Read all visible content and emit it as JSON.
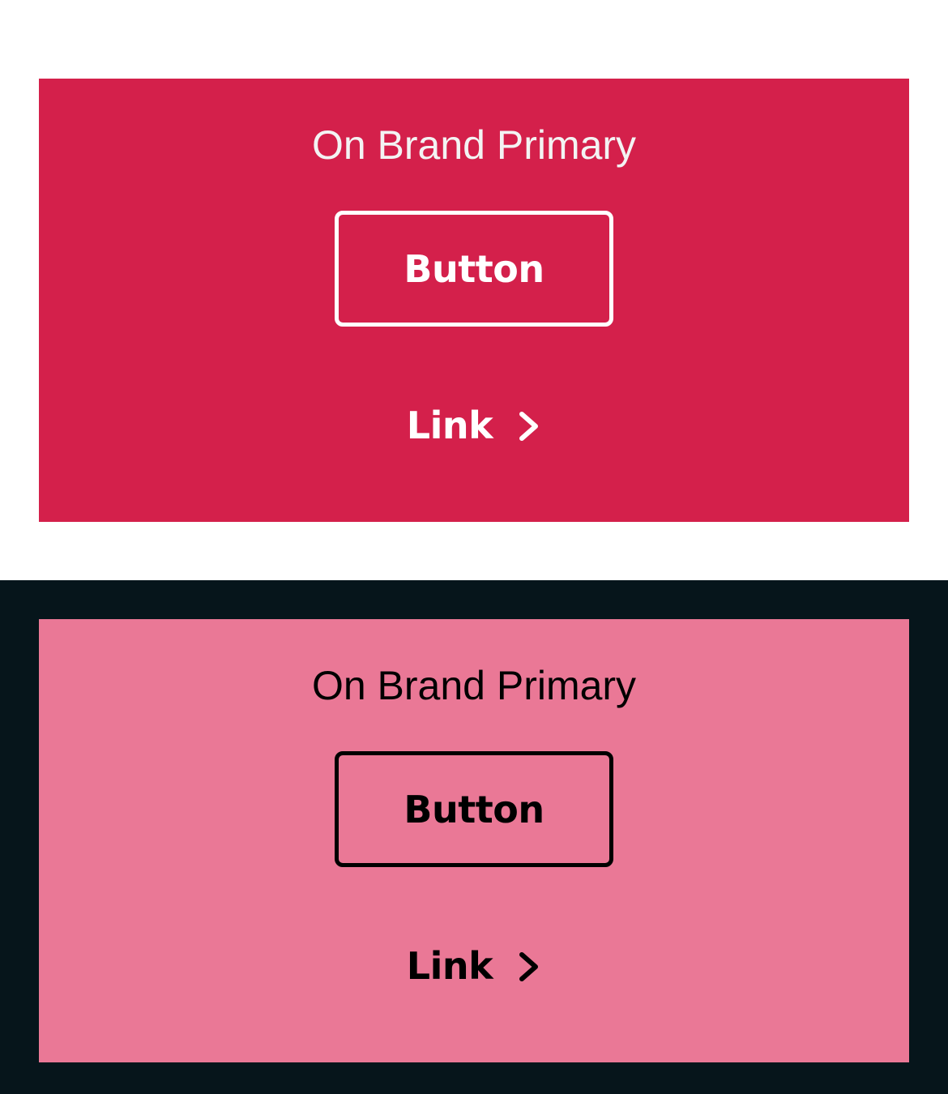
{
  "variants": [
    {
      "theme": "light",
      "page_background": "#ffffff",
      "card_background": "#d4204b",
      "foreground": "#ffffff",
      "title_color": "#f3f3f3",
      "title": "On Brand Primary",
      "button_label": "Button",
      "link_label": "Link",
      "link_icon": "chevron-right-icon"
    },
    {
      "theme": "dark",
      "page_background": "#06151b",
      "card_background": "#ea7896",
      "foreground": "#000000",
      "title_color": "#000000",
      "title": "On Brand Primary",
      "button_label": "Button",
      "link_label": "Link",
      "link_icon": "chevron-right-icon"
    }
  ]
}
